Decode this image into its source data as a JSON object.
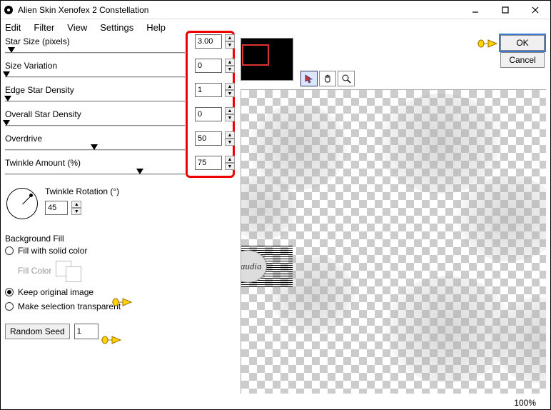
{
  "title": "Alien Skin Xenofex 2 Constellation",
  "menus": [
    "Edit",
    "Filter",
    "View",
    "Settings",
    "Help"
  ],
  "sliders": [
    {
      "label": "Star Size (pixels)",
      "value": "3.00",
      "thumb_pct": 4
    },
    {
      "label": "Size Variation",
      "value": "0",
      "thumb_pct": 0
    },
    {
      "label": "Edge Star Density",
      "value": "1",
      "thumb_pct": 1
    },
    {
      "label": "Overall Star Density",
      "value": "0",
      "thumb_pct": 0
    },
    {
      "label": "Overdrive",
      "value": "50",
      "thumb_pct": 50
    },
    {
      "label": "Twinkle Amount (%)",
      "value": "75",
      "thumb_pct": 75
    }
  ],
  "rotation": {
    "label": "Twinkle Rotation (°)",
    "value": "45"
  },
  "bgfill": {
    "title": "Background Fill",
    "opt_solid": "Fill with solid color",
    "fill_color_label": "Fill Color",
    "opt_keep": "Keep original image",
    "opt_transparent": "Make selection transparent"
  },
  "random_seed": {
    "button": "Random Seed",
    "value": "1"
  },
  "buttons": {
    "ok": "OK",
    "cancel": "Cancel"
  },
  "zoom": "100%",
  "watermark_text": "claudia",
  "icons": {
    "minimize": "minimize-icon",
    "maximize": "maximize-icon",
    "close": "close-icon",
    "app": "app-icon",
    "pointer": "pointer-tool-icon",
    "hand": "hand-tool-icon",
    "zoom": "zoom-tool-icon",
    "hand_pointer": "hand-pointer-icon"
  }
}
